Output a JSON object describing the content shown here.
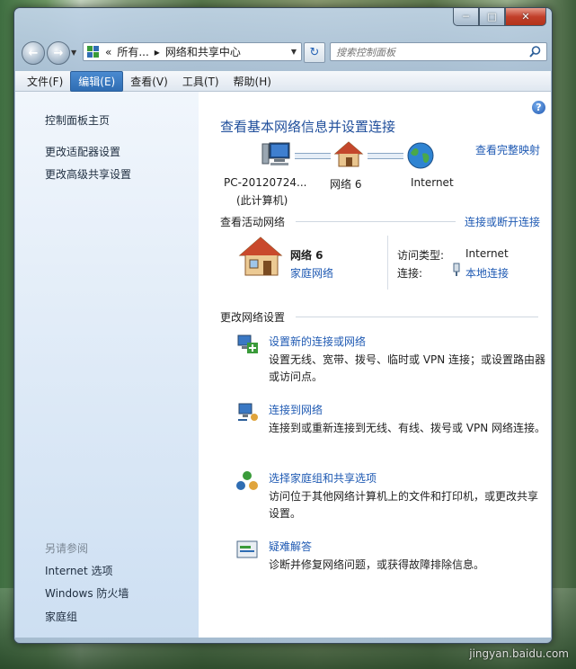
{
  "window": {
    "minimize_glyph": "─",
    "maximize_glyph": "□",
    "close_glyph": "✕"
  },
  "navbar": {
    "back_glyph": "←",
    "forward_glyph": "→",
    "breadcrumb": [
      "«",
      "所有...",
      "▸",
      "网络和共享中心"
    ],
    "search_placeholder": "搜索控制面板",
    "refresh_glyph": "↻"
  },
  "menubar": {
    "items": [
      "文件(F)",
      "编辑(E)",
      "查看(V)",
      "工具(T)",
      "帮助(H)"
    ],
    "active_index": 1
  },
  "sidebar": {
    "links": [
      "控制面板主页",
      "更改适配器设置",
      "更改高级共享设置"
    ],
    "see_also_heading": "另请参阅",
    "see_also": [
      "Internet 选项",
      "Windows 防火墙",
      "家庭组"
    ]
  },
  "main": {
    "help_glyph": "?",
    "title": "查看基本网络信息并设置连接",
    "full_map_link": "查看完整映射",
    "nodes": {
      "pc_name": "PC-20120724...",
      "pc_sub": "(此计算机)",
      "network": "网络  6",
      "internet": "Internet"
    },
    "active_section": "查看活动网络",
    "connect_disconnect_link": "连接或断开连接",
    "active_network": {
      "name": "网络  6",
      "type": "家庭网络",
      "access_label": "访问类型:",
      "access_value": "Internet",
      "connection_label": "连接:",
      "connection_value": "本地连接"
    },
    "change_section": "更改网络设置",
    "tasks": [
      {
        "title": "设置新的连接或网络",
        "desc": "设置无线、宽带、拨号、临时或 VPN 连接；或设置路由器或访问点。"
      },
      {
        "title": "连接到网络",
        "desc": "连接到或重新连接到无线、有线、拨号或 VPN 网络连接。"
      },
      {
        "title": "选择家庭组和共享选项",
        "desc": "访问位于其他网络计算机上的文件和打印机，或更改共享设置。"
      },
      {
        "title": "疑难解答",
        "desc": "诊断并修复网络问题，或获得故障排除信息。"
      }
    ]
  },
  "watermark": "jingyan.baidu.com"
}
